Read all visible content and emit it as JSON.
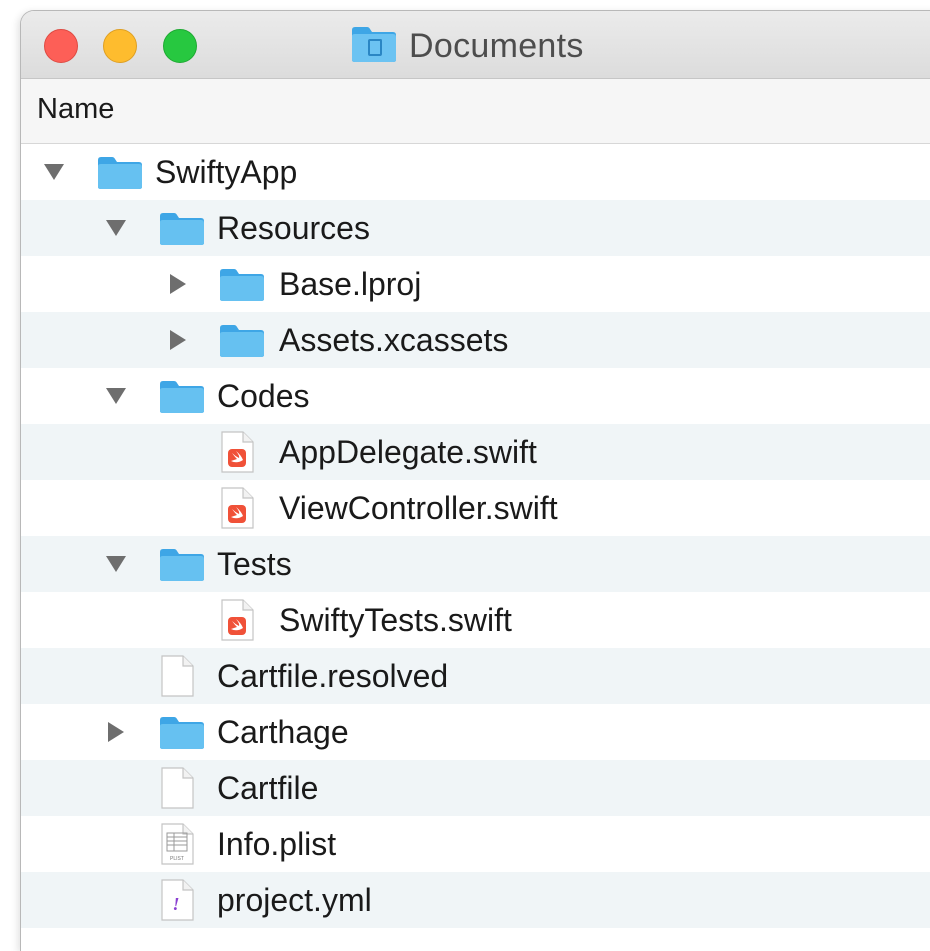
{
  "window": {
    "title": "Documents",
    "title_icon": "folder-icon"
  },
  "column_header": "Name",
  "rows": [
    {
      "label": "SwiftyApp",
      "icon": "folder-icon",
      "disclosure": "expanded",
      "depth": 0
    },
    {
      "label": "Resources",
      "icon": "folder-icon",
      "disclosure": "expanded",
      "depth": 1
    },
    {
      "label": "Base.lproj",
      "icon": "folder-icon",
      "disclosure": "collapsed",
      "depth": 2
    },
    {
      "label": "Assets.xcassets",
      "icon": "folder-icon",
      "disclosure": "collapsed",
      "depth": 2
    },
    {
      "label": "Codes",
      "icon": "folder-icon",
      "disclosure": "expanded",
      "depth": 1
    },
    {
      "label": "AppDelegate.swift",
      "icon": "swift-file-icon",
      "disclosure": "none",
      "depth": 2
    },
    {
      "label": "ViewController.swift",
      "icon": "swift-file-icon",
      "disclosure": "none",
      "depth": 2
    },
    {
      "label": "Tests",
      "icon": "folder-icon",
      "disclosure": "expanded",
      "depth": 1
    },
    {
      "label": "SwiftyTests.swift",
      "icon": "swift-file-icon",
      "disclosure": "none",
      "depth": 2
    },
    {
      "label": "Cartfile.resolved",
      "icon": "blank-file-icon",
      "disclosure": "none",
      "depth": 1
    },
    {
      "label": "Carthage",
      "icon": "folder-icon",
      "disclosure": "collapsed",
      "depth": 1
    },
    {
      "label": "Cartfile",
      "icon": "blank-file-icon",
      "disclosure": "none",
      "depth": 1
    },
    {
      "label": "Info.plist",
      "icon": "plist-file-icon",
      "disclosure": "none",
      "depth": 1,
      "icon_text": "PLIST"
    },
    {
      "label": "project.yml",
      "icon": "yaml-file-icon",
      "disclosure": "none",
      "depth": 1,
      "icon_text": "!"
    }
  ],
  "colors": {
    "alt_row": "#f0f5f7",
    "folder": "#5ab8ef",
    "swift": "#f05138",
    "disclosure": "#6e6e6e"
  }
}
